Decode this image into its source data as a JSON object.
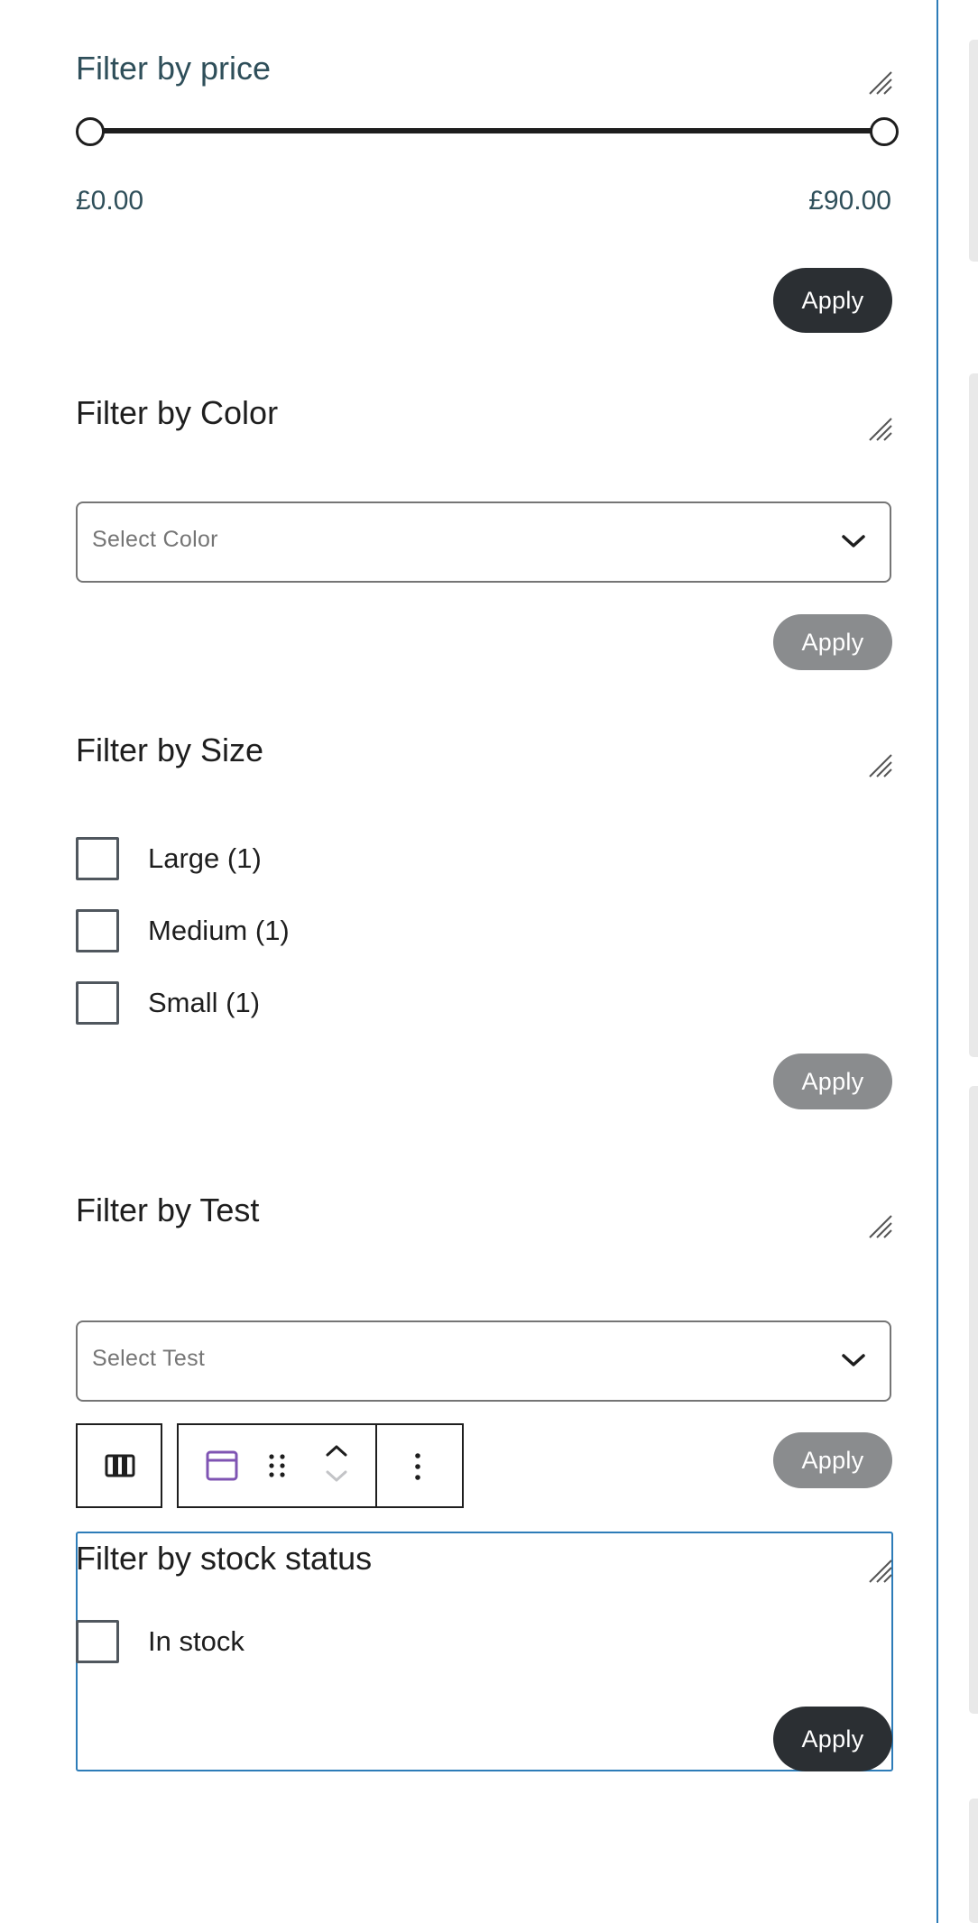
{
  "price_filter": {
    "title": "Filter by price",
    "min_price": "£0.00",
    "max_price": "£90.00",
    "range_min_fraction": 0,
    "range_max_fraction": 1,
    "apply_label": "Apply"
  },
  "color_filter": {
    "title": "Filter by Color",
    "select_placeholder": "Select Color",
    "apply_label": "Apply"
  },
  "size_filter": {
    "title": "Filter by Size",
    "options": [
      {
        "label": "Large (1)",
        "checked": false
      },
      {
        "label": "Medium (1)",
        "checked": false
      },
      {
        "label": "Small (1)",
        "checked": false
      }
    ],
    "apply_label": "Apply"
  },
  "test_filter": {
    "title": "Filter by Test",
    "select_placeholder": "Select Test",
    "apply_label": "Apply"
  },
  "block_toolbar": {
    "buttons": [
      {
        "name": "block-type-icon"
      },
      {
        "name": "parent-block-icon"
      },
      {
        "name": "drag-handle-icon"
      },
      {
        "name": "move-up-icon"
      },
      {
        "name": "move-down-icon"
      },
      {
        "name": "options-more-icon"
      }
    ]
  },
  "stock_filter": {
    "title": "Filter by stock status",
    "options": [
      {
        "label": "In stock",
        "checked": false
      }
    ],
    "apply_label": "Apply"
  },
  "colors": {
    "accent_blue": "#2d7cb8",
    "dark_button": "#2b2f33",
    "disabled_button": "#8a8c8e",
    "heading_teal": "#2f4f5a",
    "block_icon_purple": "#7f54b3"
  }
}
